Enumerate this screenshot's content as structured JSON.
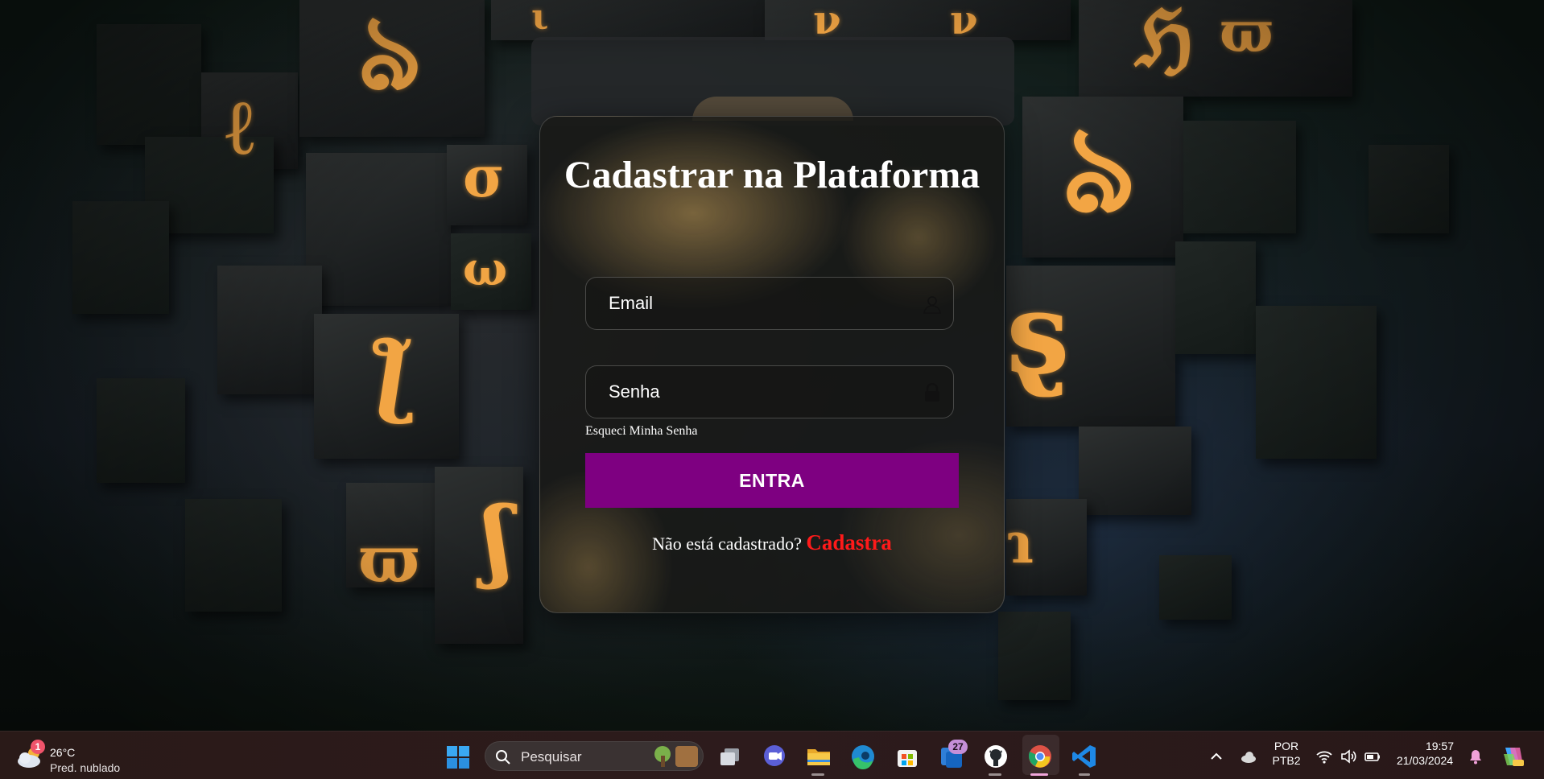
{
  "form": {
    "title": "Cadastrar na Plataforma",
    "email_placeholder": "Email",
    "password_placeholder": "Senha",
    "forgot_link": "Esqueci Minha Senha",
    "submit_label": "ENTRA",
    "register_prompt": "Não está cadastrado?",
    "register_link": "Cadastra",
    "submit_color": "#7e0081",
    "register_link_color": "#ff1a1a"
  },
  "taskbar": {
    "weather": {
      "badge": "1",
      "temperature": "26°C",
      "description": "Pred. nublado",
      "icon": "cloudy-icon"
    },
    "search": {
      "placeholder": "Pesquisar"
    },
    "apps": [
      {
        "name": "task-view",
        "icon": "task-view-icon"
      },
      {
        "name": "teams-chat",
        "icon": "chat-icon"
      },
      {
        "name": "file-explorer",
        "icon": "folder-icon"
      },
      {
        "name": "edge",
        "icon": "edge-icon"
      },
      {
        "name": "microsoft-store",
        "icon": "store-icon"
      },
      {
        "name": "todo",
        "icon": "todo-icon",
        "badge": "27"
      },
      {
        "name": "github",
        "icon": "github-icon"
      },
      {
        "name": "chrome",
        "icon": "chrome-icon"
      },
      {
        "name": "vscode",
        "icon": "vscode-icon"
      }
    ],
    "tray": {
      "language_top": "POR",
      "language_bottom": "PTB2",
      "time": "19:57",
      "date": "21/03/2024"
    }
  }
}
